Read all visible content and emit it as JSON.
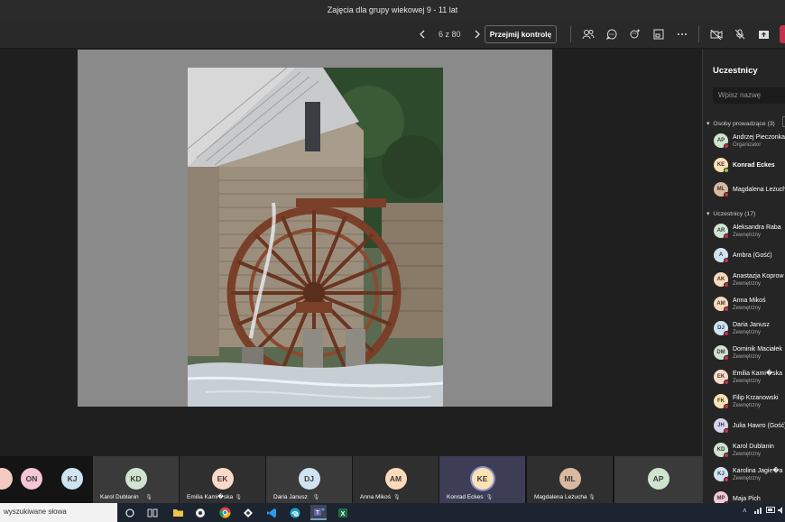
{
  "window": {
    "title": "Zajęcia dla grupy wiekowej 9 - 11 lat"
  },
  "toolbar": {
    "page_indicator": "6 z 80",
    "take_control_label": "Przejmij kontrolę",
    "icons": [
      "participants-icon",
      "chat-icon",
      "reactions-icon",
      "rooms-icon",
      "more-icon",
      "camera-off-icon",
      "mic-off-icon",
      "share-icon"
    ]
  },
  "colors": {
    "accent": "#6264a7",
    "leave": "#c4314b",
    "online": "#92c353",
    "offline": "#c4314b"
  },
  "panel": {
    "title": "Uczestnicy",
    "search_placeholder": "Wpisz nazwę",
    "presenters": {
      "header": "Osoby prowadzące (3)",
      "people": [
        {
          "initials": "AP",
          "name": "Andrzej Pieczonka",
          "role": "Organizator",
          "avatar_color": "#cfe3cf",
          "status": "offline"
        },
        {
          "initials": "KE",
          "name": "Konrad Eckes",
          "role": "",
          "avatar_color": "#fbe2b4",
          "status": "online"
        },
        {
          "initials": "ML",
          "name": "Magdalena Leżuch",
          "role": "",
          "avatar_color": "#d9b9a0",
          "status": "offline"
        }
      ]
    },
    "attendees": {
      "header": "Uczestnicy (17)",
      "people": [
        {
          "initials": "AR",
          "name": "Aleksandra Raba",
          "role": "Zewnętrzny",
          "avatar_color": "#cfe3cf",
          "status": "offline"
        },
        {
          "initials": "A",
          "name": "Ambra (Gość)",
          "role": "",
          "avatar_color": "#cfe4f0",
          "status": "offline"
        },
        {
          "initials": "AK",
          "name": "Anastazja Koprow",
          "role": "Zewnętrzny",
          "avatar_color": "#fbd9b9",
          "status": "offline"
        },
        {
          "initials": "AM",
          "name": "Anna Mikoś",
          "role": "Zewnętrzny",
          "avatar_color": "#fbd9b9",
          "status": "offline"
        },
        {
          "initials": "DJ",
          "name": "Daria Janusz",
          "role": "Zewnętrzny",
          "avatar_color": "#cfe4f0",
          "status": "offline"
        },
        {
          "initials": "DM",
          "name": "Dominik Maciałek",
          "role": "Zewnętrzny",
          "avatar_color": "#cfe3cf",
          "status": "offline"
        },
        {
          "initials": "EK",
          "name": "Emilia Kami�ska",
          "role": "Zewnętrzny",
          "avatar_color": "#fbd9c9",
          "status": "offline"
        },
        {
          "initials": "FK",
          "name": "Filip Krzanowski",
          "role": "Zewnętrzny",
          "avatar_color": "#fbe2b4",
          "status": "offline"
        },
        {
          "initials": "JH",
          "name": "Julia Hawro (Gość)",
          "role": "",
          "avatar_color": "#d9d4ef",
          "status": "offline"
        },
        {
          "initials": "KD",
          "name": "Karol Dublanin",
          "role": "Zewnętrzny",
          "avatar_color": "#cfe3cf",
          "status": "offline"
        },
        {
          "initials": "KJ",
          "name": "Karolina Jagie�a",
          "role": "Zewnętrzny",
          "avatar_color": "#cfe4f0",
          "status": "offline"
        },
        {
          "initials": "MP",
          "name": "Maja Pich",
          "role": "",
          "avatar_color": "#f4c6d6",
          "status": "offline"
        }
      ]
    }
  },
  "strip": {
    "mini": [
      {
        "initials": "ON",
        "avatar_color": "#f4c6d6"
      },
      {
        "initials": "KJ",
        "avatar_color": "#cfe4f0"
      }
    ],
    "tiles": [
      {
        "initials": "KD",
        "name": "Karol Dublanin",
        "avatar_color": "#cfe3cf"
      },
      {
        "initials": "EK",
        "name": "Emilia Kami�ska",
        "avatar_color": "#fbd9c9"
      },
      {
        "initials": "DJ",
        "name": "Daria Janusz",
        "avatar_color": "#cfe4f0"
      },
      {
        "initials": "AM",
        "name": "Anna Mikoś",
        "avatar_color": "#fbd9b9"
      },
      {
        "initials": "KE",
        "name": "Konrad Eckes",
        "avatar_color": "#fbe2b4"
      },
      {
        "initials": "ML",
        "name": "Magdalena Leżucha",
        "avatar_color": "#d9b9a0"
      },
      {
        "initials": "AP",
        "name": "",
        "avatar_color": "#cfe3cf"
      }
    ]
  },
  "taskbar": {
    "search_text": "wyszukiwane słowa",
    "apps": [
      "cortana-icon",
      "task-view-icon",
      "file-explorer-icon",
      "app-icon",
      "chrome-icon",
      "app-icon",
      "vscode-icon",
      "edge-icon",
      "teams-icon",
      "excel-icon"
    ]
  }
}
